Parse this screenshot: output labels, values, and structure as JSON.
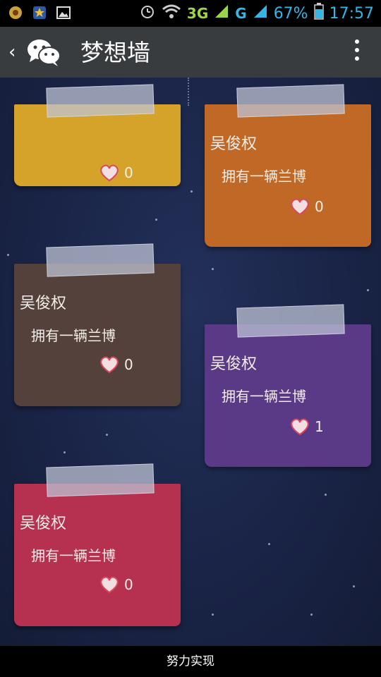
{
  "status_bar": {
    "network_3g": "3G",
    "network_g": "G",
    "battery": "67%",
    "time": "17:57"
  },
  "title_bar": {
    "back_glyph": "‹",
    "title": "梦想墙"
  },
  "notes": [
    {
      "color": "#d5a32a",
      "name": "",
      "wish": "",
      "likes": "0"
    },
    {
      "color": "#c06826",
      "name": "吴俊权",
      "wish": "拥有一辆兰博",
      "likes": "0"
    },
    {
      "color": "#54413b",
      "name": "吴俊权",
      "wish": "拥有一辆兰博",
      "likes": "0"
    },
    {
      "color": "#5a3a86",
      "name": "吴俊权",
      "wish": "拥有一辆兰博",
      "likes": "1"
    },
    {
      "color": "#b6304f",
      "name": "吴俊权",
      "wish": "拥有一辆兰博",
      "likes": "0"
    }
  ],
  "bottom_bar": {
    "label": "努力实现"
  },
  "icons": [
    "wechat-icon",
    "overflow-menu-icon",
    "heart-icon",
    "alarm-icon",
    "wifi-icon",
    "signal-icon",
    "battery-icon"
  ]
}
